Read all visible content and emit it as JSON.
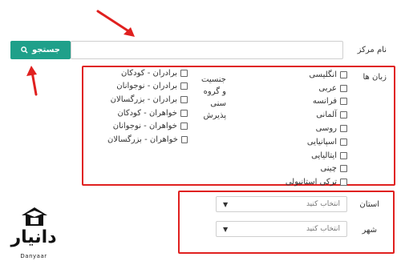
{
  "form": {
    "center_name_label": "نام مرکز",
    "search_button_label": "جستجو",
    "languages_label": "زبان ها",
    "languages": [
      "انگلیسی",
      "عربی",
      "فرانسه",
      "آلمانی",
      "روسی",
      "اسپانیایی",
      "ایتالیایی",
      "چینی",
      "ترکی استانبولی"
    ],
    "gender_age_label_lines": [
      "جنسیت",
      "و گروه",
      "سنی",
      "پذیرش"
    ],
    "groups": [
      "برادران - کودکان",
      "برادران - نوجوانان",
      "برادران - بزرگسالان",
      "خواهران - کودکان",
      "خواهران - نوجوانان",
      "خواهران - بزرگسالان"
    ],
    "province_label": "استان",
    "province_value": "انتخاب کنید",
    "city_label": "شهر",
    "city_value": "انتخاب کنید"
  },
  "logo": {
    "text": "دانیار",
    "subtext": "Danyaar"
  },
  "colors": {
    "accent": "#1fa08a",
    "highlight": "#e0201f"
  }
}
